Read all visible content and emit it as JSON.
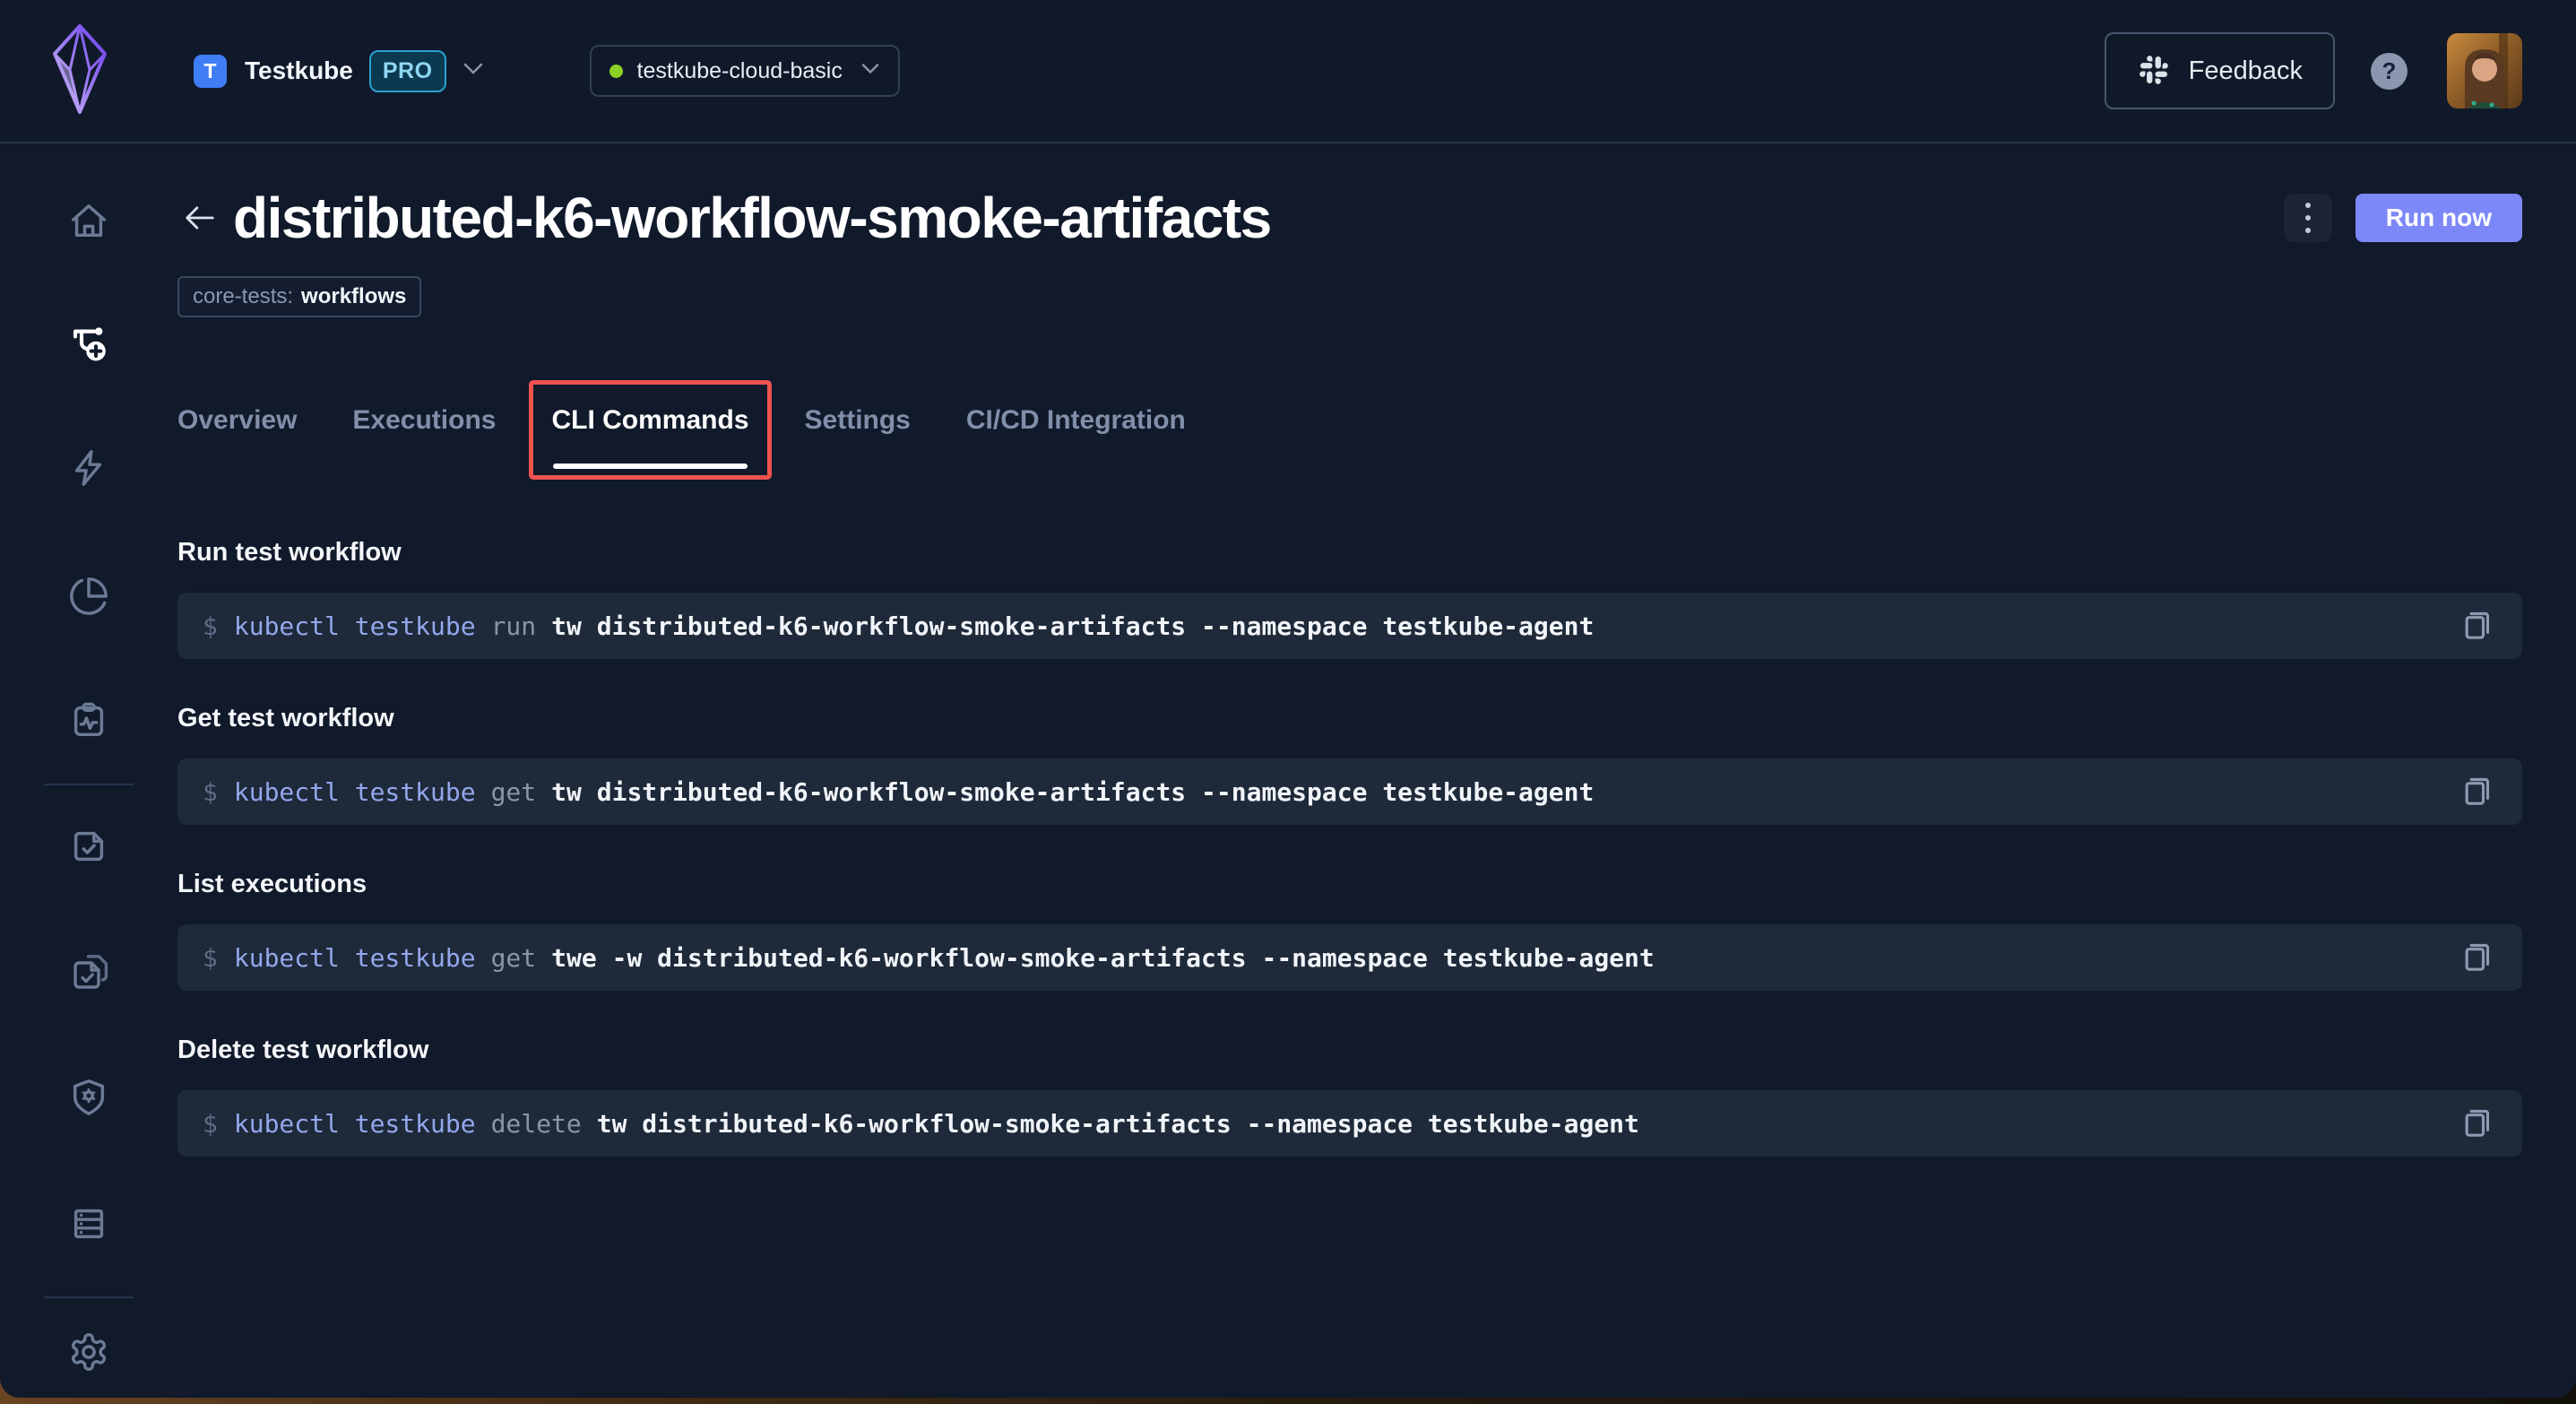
{
  "topbar": {
    "org_initial": "T",
    "org_name": "Testkube",
    "plan_badge": "PRO",
    "environment": "testkube-cloud-basic",
    "feedback_label": "Feedback",
    "help_label": "?"
  },
  "page": {
    "title": "distributed-k6-workflow-smoke-artifacts",
    "label_key": "core-tests:",
    "label_value": "workflows",
    "run_button_label": "Run now"
  },
  "tabs": [
    {
      "label": "Overview",
      "active": false
    },
    {
      "label": "Executions",
      "active": false
    },
    {
      "label": "CLI Commands",
      "active": true,
      "highlighted": true
    },
    {
      "label": "Settings",
      "active": false
    },
    {
      "label": "CI/CD Integration",
      "active": false
    }
  ],
  "sections": [
    {
      "heading": "Run test workflow",
      "prompt": "$",
      "cmd_base": "kubectl testkube",
      "cmd_verb": "run",
      "cmd_args": "tw distributed-k6-workflow-smoke-artifacts --namespace testkube-agent"
    },
    {
      "heading": "Get test workflow",
      "prompt": "$",
      "cmd_base": "kubectl testkube",
      "cmd_verb": "get",
      "cmd_args": "tw distributed-k6-workflow-smoke-artifacts --namespace testkube-agent"
    },
    {
      "heading": "List executions",
      "prompt": "$",
      "cmd_base": "kubectl testkube",
      "cmd_verb": "get",
      "cmd_args": "twe -w distributed-k6-workflow-smoke-artifacts --namespace testkube-agent"
    },
    {
      "heading": "Delete test workflow",
      "prompt": "$",
      "cmd_base": "kubectl testkube",
      "cmd_verb": "delete",
      "cmd_args": "tw distributed-k6-workflow-smoke-artifacts --namespace testkube-agent"
    }
  ],
  "sidebar": {
    "icons": [
      "home-icon",
      "test-workflow-add-icon",
      "lightning-icon",
      "pie-chart-icon",
      "clipboard-pulse-icon",
      "file-check-icon",
      "files-check-icon",
      "shield-gear-icon",
      "server-rack-icon",
      "settings-gear-icon"
    ],
    "active_icon": "test-workflow-add-icon"
  },
  "colors": {
    "page_background": "#111a2b",
    "topbar_background": "#101929",
    "code_block_background": "#1e2939",
    "accent_run_button": "#7d88f8",
    "highlight_red": "#ee5350",
    "code_command_blue": "#93a7ec",
    "env_status_green": "#8bd125",
    "pro_badge_cyan": "#8fd6f2",
    "logo_purple": "#8b5cf6"
  }
}
